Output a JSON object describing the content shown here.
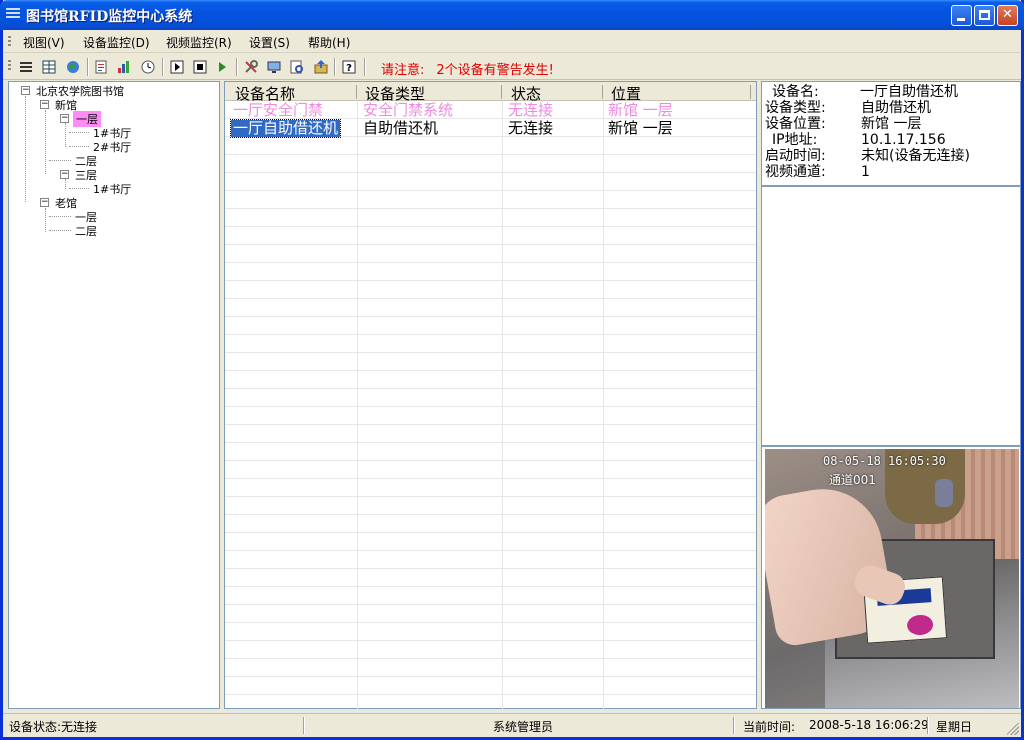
{
  "window": {
    "title": "图书馆RFID监控中心系统",
    "icons": {
      "app": "app-menu-icon",
      "minimize": "minimize-icon",
      "maximize": "maximize-icon",
      "close": "close-icon"
    },
    "close_glyph": "✕"
  },
  "menu": {
    "items": [
      {
        "label": "视图(V)"
      },
      {
        "label": "设备监控(D)"
      },
      {
        "label": "视频监控(R)"
      },
      {
        "label": "设置(S)"
      },
      {
        "label": "帮助(H)"
      }
    ]
  },
  "toolbar": {
    "tools": [
      "list-view-icon",
      "grid-view-icon",
      "globe-icon",
      "report-icon",
      "chart-icon",
      "clock-icon",
      "play-step-icon",
      "stop-icon",
      "play-icon",
      "tools-icon",
      "monitor-icon",
      "print-preview-icon",
      "export-icon",
      "help-icon"
    ],
    "help_glyph": "?",
    "warning_label": "请注意:",
    "warning_text": "2个设备有警告发生!"
  },
  "tree": {
    "root": "北京农学院图书馆",
    "new_building": "新馆",
    "floor1": "一层",
    "hall1": "1#书厅",
    "hall2": "2#书厅",
    "floor2": "二层",
    "floor3": "三层",
    "floor3_hall1": "1#书厅",
    "old_building": "老馆",
    "old_floor1": "一层",
    "old_floor2": "二层",
    "collapse_glyph": "−"
  },
  "list": {
    "columns": [
      "设备名称",
      "设备类型",
      "状态",
      "位置"
    ],
    "rows": [
      {
        "name": "一厅安全门禁",
        "type": "安全门禁系统",
        "status": "无连接",
        "location": "新馆 一层",
        "alarm": true
      },
      {
        "name": "一厅自助借还机",
        "type": "自助借还机",
        "status": "无连接",
        "location": "新馆 一层",
        "selected": true
      }
    ]
  },
  "info": {
    "device_name_label": "设备名:",
    "device_name": "一厅自助借还机",
    "device_type_label": "设备类型:",
    "device_type": "自助借还机",
    "device_location_label": "设备位置:",
    "device_location": "新馆 一层",
    "ip_label": "IP地址:",
    "ip": "10.1.17.156",
    "start_time_label": "启动时间:",
    "start_time": "未知(设备无连接)",
    "video_channel_label": "视频通道:",
    "video_channel": "1"
  },
  "video": {
    "timestamp": "08-05-18 16:05:30",
    "channel": "通道001"
  },
  "status": {
    "device_status": "设备状态:无连接",
    "user": "系统管理员",
    "time_label": "当前时间:",
    "time": "2008-5-18 16:06:29",
    "weekday": "星期日"
  },
  "colors": {
    "alarm_row": "#f08ae0",
    "tree_selected": "#ff8cf4",
    "warning": "#e00000",
    "selection": "#316ac5"
  }
}
